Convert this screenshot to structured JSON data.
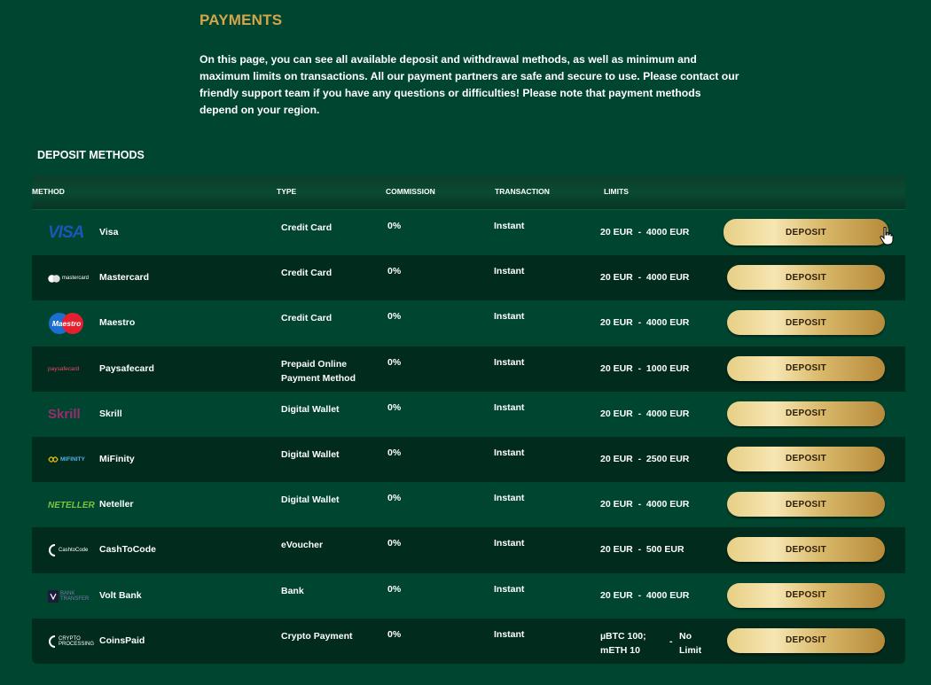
{
  "page": {
    "title": "PAYMENTS",
    "intro": "On this page, you can see all available deposit and withdrawal methods, as well as minimum and maximum limits on transactions. All our payment partners are safe and secure to use. Please contact our friendly support team if you have any questions or difficulties! Please note that payment methods depend on your region."
  },
  "deposit": {
    "section_title": "DEPOSIT METHODS",
    "headers": {
      "method": "METHOD",
      "type": "TYPE",
      "commission": "COMMISSION",
      "transaction": "TRANSACTION",
      "limits": "LIMITS"
    },
    "button_label": "DEPOSIT",
    "rows": [
      {
        "name": "Visa",
        "logo_text": "VISA",
        "type": "Credit Card",
        "commission": "0%",
        "transaction": "Instant",
        "limits": "20 EUR  -  4000 EUR"
      },
      {
        "name": "Mastercard",
        "logo_text": "mastercard",
        "type": "Credit Card",
        "commission": "0%",
        "transaction": "Instant",
        "limits": "20 EUR  -  4000 EUR"
      },
      {
        "name": "Maestro",
        "logo_text": "Maestro",
        "type": "Credit Card",
        "commission": "0%",
        "transaction": "Instant",
        "limits": "20 EUR  -  4000 EUR"
      },
      {
        "name": "Paysafecard",
        "logo_text": "paysafecard",
        "type": "Prepaid Online Payment Method",
        "commission": "0%",
        "transaction": "Instant",
        "limits": "20 EUR  -  1000 EUR"
      },
      {
        "name": "Skrill",
        "logo_text": "Skrill",
        "type": "Digital Wallet",
        "commission": "0%",
        "transaction": "Instant",
        "limits": "20 EUR  -  4000 EUR"
      },
      {
        "name": "MiFinity",
        "logo_text": "MIFINITY",
        "type": "Digital Wallet",
        "commission": "0%",
        "transaction": "Instant",
        "limits": "20 EUR  -  2500 EUR"
      },
      {
        "name": "Neteller",
        "logo_text": "NETELLER",
        "type": "Digital Wallet",
        "commission": "0%",
        "transaction": "Instant",
        "limits": "20 EUR  -  4000 EUR"
      },
      {
        "name": "CashToCode",
        "logo_text": "CashtoCode",
        "type": "eVoucher",
        "commission": "0%",
        "transaction": "Instant",
        "limits": "20 EUR  -  500 EUR"
      },
      {
        "name": "Volt Bank",
        "logo_text": "BANK TRANSFER",
        "type": "Bank",
        "commission": "0%",
        "transaction": "Instant",
        "limits": "20 EUR  -  4000 EUR"
      },
      {
        "name": "CoinsPaid",
        "logo_text": "CRYPTO PROCESSING",
        "type": "Crypto Payment",
        "commission": "0%",
        "transaction": "Instant",
        "limits_min": "µBTC 100; mETH 10",
        "limits_dash": "-",
        "limits_max": "No Limit"
      }
    ]
  },
  "colors": {
    "background": "#004530",
    "title_gold": "#d4a64a",
    "row_light": "#00452f",
    "row_dark": "#012b1c",
    "button_gold": "#e7cf86"
  }
}
